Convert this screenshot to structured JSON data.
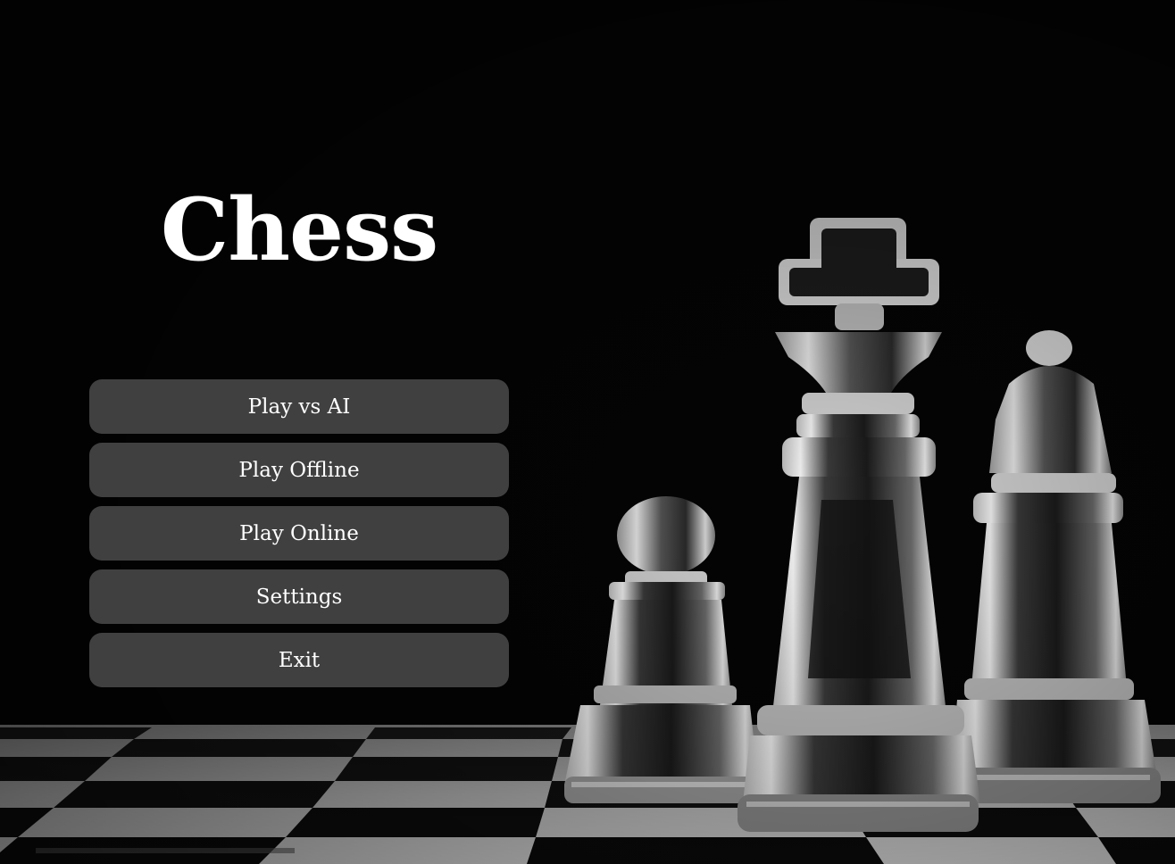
{
  "title": "Chess",
  "menu": {
    "items": [
      {
        "label": "Play vs AI"
      },
      {
        "label": "Play Offline"
      },
      {
        "label": "Play Online"
      },
      {
        "label": "Settings"
      },
      {
        "label": "Exit"
      }
    ]
  },
  "colors": {
    "background": "#030303",
    "button": "#404040",
    "text": "#ffffff"
  },
  "background_image": {
    "pieces": [
      "pawn-piece",
      "king-piece",
      "bishop-piece"
    ],
    "board": "checkerboard"
  }
}
